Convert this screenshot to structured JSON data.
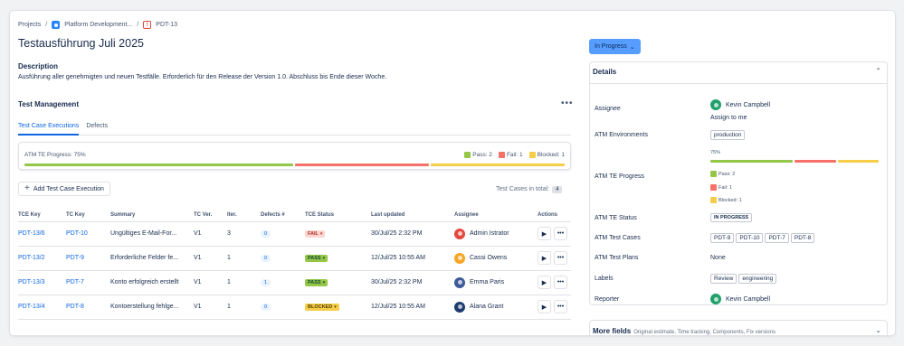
{
  "breadcrumb": [
    "Projects",
    "Platform Development...",
    "PDT-13"
  ],
  "title": "Testausführung Juli 2025",
  "description": {
    "heading": "Description",
    "text": "Ausführung aller genehmigten und neuen Testfälle. Erforderlich für den Release der Version 1.0. Abschluss bis Ende dieser Woche."
  },
  "test_management": {
    "heading": "Test Management",
    "tabs": [
      "Test Case Executions",
      "Defects"
    ],
    "progress": {
      "label": "ATM TE Progress: 75%",
      "pass_label": "Pass: 2",
      "fail_label": "Fail: 1",
      "blocked_label": "Blocked: 1",
      "pass": 2,
      "fail": 1,
      "blocked": 1,
      "colors": {
        "pass": "#94c748",
        "fail": "#f87168",
        "blocked": "#f5cd47"
      }
    },
    "add_button": "Add Test Case Execution",
    "total_label": "Test Cases in total:",
    "total_count": "4",
    "columns": [
      "TCE Key",
      "TC Key",
      "Summary",
      "TC Ver.",
      "Iter.",
      "Defects #",
      "TCE Status",
      "Last updated",
      "Assignee",
      "Actions"
    ],
    "rows": [
      {
        "tce": "PDT-13/6",
        "tc": "PDT-10",
        "summary": "Ungültiges E-Mail-For...",
        "ver": "V1",
        "iter": "3",
        "defects": "0",
        "status": "FAIL",
        "status_kind": "fail",
        "updated": "30/Jul/25 2:32 PM",
        "assignee": "Admin Istrator",
        "avatar_color": "#e2483d"
      },
      {
        "tce": "PDT-13/2",
        "tc": "PDT-9",
        "summary": "Erforderliche Felder fe...",
        "ver": "V1",
        "iter": "1",
        "defects": "0",
        "status": "PASS",
        "status_kind": "pass",
        "updated": "12/Jul/25 10:55 AM",
        "assignee": "Cassi Owens",
        "avatar_color": "#f5a623"
      },
      {
        "tce": "PDT-13/3",
        "tc": "PDT-7",
        "summary": "Konto erfolgreich erstellt",
        "ver": "V1",
        "iter": "1",
        "defects": "1",
        "status": "PASS",
        "status_kind": "pass",
        "updated": "30/Jul/25 2:32 PM",
        "assignee": "Emma Paris",
        "avatar_color": "#3d5a99"
      },
      {
        "tce": "PDT-13/4",
        "tc": "PDT-8",
        "summary": "Kontoerstellung fehlge...",
        "ver": "V1",
        "iter": "1",
        "defects": "0",
        "status": "BLOCKED",
        "status_kind": "blocked",
        "updated": "12/Jul/25 10:55 AM",
        "assignee": "Alana Grant",
        "avatar_color": "#1d3b6e"
      }
    ]
  },
  "status_button": "In Progress",
  "details": {
    "heading": "Details",
    "assignee_label": "Assignee",
    "assignee": "Kevin Campbell",
    "assign_to_me": "Assign to me",
    "environments_label": "ATM Environments",
    "environment": "production",
    "progress_label": "ATM TE Progress",
    "progress_pct": "75%",
    "pass_label": "Pass: 2",
    "fail_label": "Fail: 1",
    "blocked_label": "Blocked: 1",
    "status_label": "ATM TE Status",
    "status_value": "IN PROGRESS",
    "cases_label": "ATM Test Cases",
    "cases": [
      "PDT-9",
      "PDT-10",
      "PDT-7",
      "PDT-8"
    ],
    "plans_label": "ATM Test Plans",
    "plans_value": "None",
    "labels_label": "Labels",
    "labels": [
      "Review",
      "engineering"
    ],
    "reporter_label": "Reporter",
    "reporter": "Kevin Campbell"
  },
  "more_fields": {
    "heading": "More fields",
    "sub": "Original estimate, Time tracking, Components, Fix versions"
  }
}
